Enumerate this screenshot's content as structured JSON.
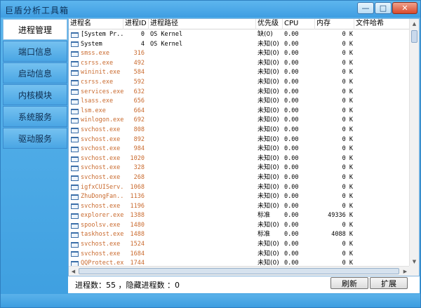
{
  "window": {
    "title": "巨盾分析工具箱",
    "minimize_glyph": "—",
    "maximize_glyph": "□",
    "close_glyph": "✕"
  },
  "sidebar": {
    "items": [
      {
        "label": "进程管理",
        "active": true
      },
      {
        "label": "端口信息",
        "active": false
      },
      {
        "label": "启动信息",
        "active": false
      },
      {
        "label": "内核模块",
        "active": false
      },
      {
        "label": "系统服务",
        "active": false
      },
      {
        "label": "驱动服务",
        "active": false
      }
    ]
  },
  "table": {
    "columns": [
      "进程名",
      "进程ID",
      "进程路径",
      "优先级",
      "CPU",
      "内存",
      "文件哈希"
    ],
    "rows": [
      {
        "name": "[System Pr...",
        "pid": "0",
        "path": "OS Kernel",
        "prio": "缺(0)",
        "cpu": "0.00",
        "mem": "0 K",
        "kind": "sys"
      },
      {
        "name": "System",
        "pid": "4",
        "path": "OS Kernel",
        "prio": "未知(0)",
        "cpu": "0.00",
        "mem": "0 K",
        "kind": "sys"
      },
      {
        "name": "smss.exe",
        "pid": "316",
        "path": "",
        "prio": "未知(0)",
        "cpu": "0.00",
        "mem": "0 K",
        "kind": "usr"
      },
      {
        "name": "csrss.exe",
        "pid": "492",
        "path": "",
        "prio": "未知(0)",
        "cpu": "0.00",
        "mem": "0 K",
        "kind": "usr"
      },
      {
        "name": "wininit.exe",
        "pid": "584",
        "path": "",
        "prio": "未知(0)",
        "cpu": "0.00",
        "mem": "0 K",
        "kind": "usr"
      },
      {
        "name": "csrss.exe",
        "pid": "592",
        "path": "",
        "prio": "未知(0)",
        "cpu": "0.00",
        "mem": "0 K",
        "kind": "usr"
      },
      {
        "name": "services.exe",
        "pid": "632",
        "path": "",
        "prio": "未知(0)",
        "cpu": "0.00",
        "mem": "0 K",
        "kind": "usr"
      },
      {
        "name": "lsass.exe",
        "pid": "656",
        "path": "",
        "prio": "未知(0)",
        "cpu": "0.00",
        "mem": "0 K",
        "kind": "usr"
      },
      {
        "name": "lsm.exe",
        "pid": "664",
        "path": "",
        "prio": "未知(0)",
        "cpu": "0.00",
        "mem": "0 K",
        "kind": "usr"
      },
      {
        "name": "winlogon.exe",
        "pid": "692",
        "path": "",
        "prio": "未知(0)",
        "cpu": "0.00",
        "mem": "0 K",
        "kind": "usr"
      },
      {
        "name": "svchost.exe",
        "pid": "808",
        "path": "",
        "prio": "未知(0)",
        "cpu": "0.00",
        "mem": "0 K",
        "kind": "usr"
      },
      {
        "name": "svchost.exe",
        "pid": "892",
        "path": "",
        "prio": "未知(0)",
        "cpu": "0.00",
        "mem": "0 K",
        "kind": "usr"
      },
      {
        "name": "svchost.exe",
        "pid": "984",
        "path": "",
        "prio": "未知(0)",
        "cpu": "0.00",
        "mem": "0 K",
        "kind": "usr"
      },
      {
        "name": "svchost.exe",
        "pid": "1020",
        "path": "",
        "prio": "未知(0)",
        "cpu": "0.00",
        "mem": "0 K",
        "kind": "usr"
      },
      {
        "name": "svchost.exe",
        "pid": "328",
        "path": "",
        "prio": "未知(0)",
        "cpu": "0.00",
        "mem": "0 K",
        "kind": "usr"
      },
      {
        "name": "svchost.exe",
        "pid": "268",
        "path": "",
        "prio": "未知(0)",
        "cpu": "0.00",
        "mem": "0 K",
        "kind": "usr"
      },
      {
        "name": "igfxCUIServ...",
        "pid": "1068",
        "path": "",
        "prio": "未知(0)",
        "cpu": "0.00",
        "mem": "0 K",
        "kind": "usr"
      },
      {
        "name": "ZhuDongFan...",
        "pid": "1136",
        "path": "",
        "prio": "未知(0)",
        "cpu": "0.00",
        "mem": "0 K",
        "kind": "usr"
      },
      {
        "name": "svchost.exe",
        "pid": "1196",
        "path": "",
        "prio": "未知(0)",
        "cpu": "0.00",
        "mem": "0 K",
        "kind": "usr"
      },
      {
        "name": "explorer.exe",
        "pid": "1388",
        "path": "",
        "prio": "标准",
        "cpu": "0.00",
        "mem": "49336 K",
        "kind": "usr"
      },
      {
        "name": "spoolsv.exe",
        "pid": "1480",
        "path": "",
        "prio": "未知(0)",
        "cpu": "0.00",
        "mem": "0 K",
        "kind": "usr"
      },
      {
        "name": "taskhost.exe",
        "pid": "1488",
        "path": "",
        "prio": "标准",
        "cpu": "0.00",
        "mem": "4088 K",
        "kind": "usr"
      },
      {
        "name": "svchost.exe",
        "pid": "1524",
        "path": "",
        "prio": "未知(0)",
        "cpu": "0.00",
        "mem": "0 K",
        "kind": "usr"
      },
      {
        "name": "svchost.exe",
        "pid": "1684",
        "path": "",
        "prio": "未知(0)",
        "cpu": "0.00",
        "mem": "0 K",
        "kind": "usr"
      },
      {
        "name": "QQProtect.exe",
        "pid": "1744",
        "path": "",
        "prio": "未知(0)",
        "cpu": "0.00",
        "mem": "0 K",
        "kind": "usr"
      }
    ]
  },
  "status": {
    "text": "进程数：55 ，隐藏进程数 ：0"
  },
  "buttons": {
    "refresh": "刷新",
    "expand": "扩展"
  },
  "colors": {
    "accent": "#3e9fe0",
    "system_process": "#000000",
    "user_process": "#c96a2e"
  }
}
